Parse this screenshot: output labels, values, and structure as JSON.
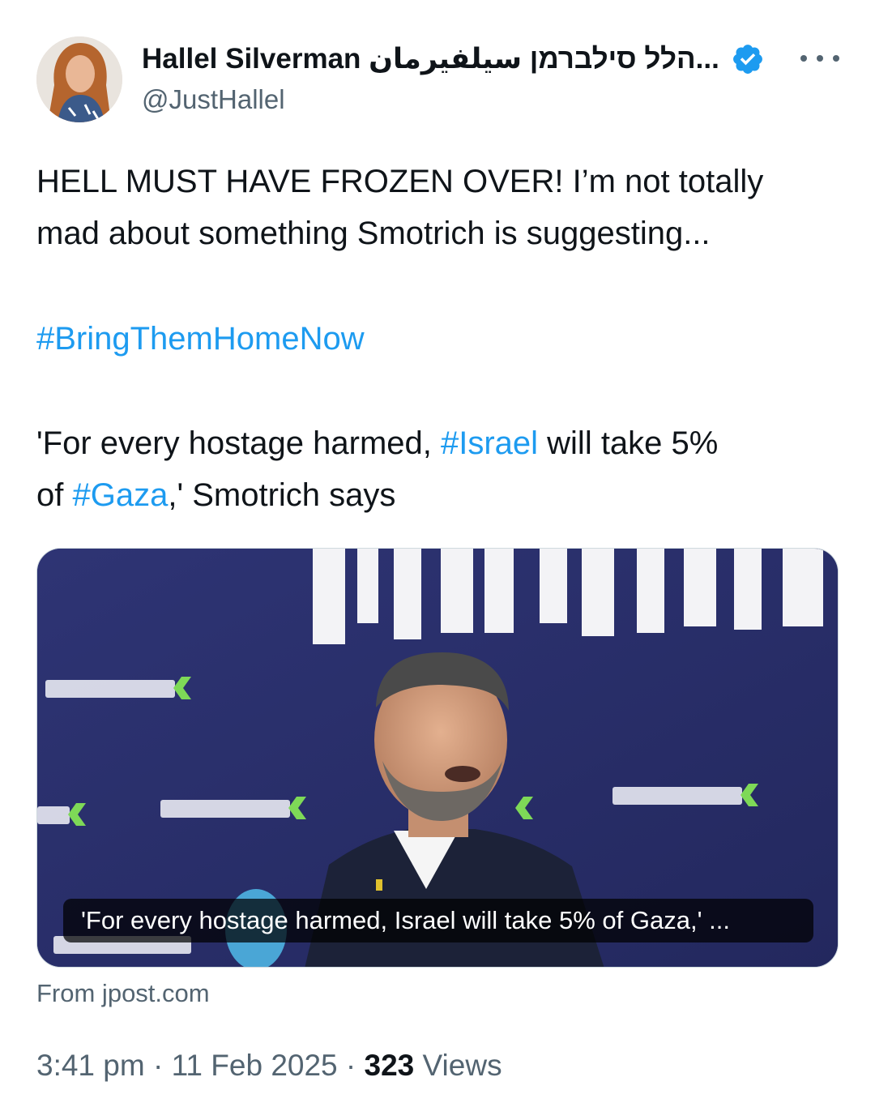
{
  "author": {
    "display_name": "Hallel Silverman הלל סילברמן سيلفيرمان...",
    "handle": "@JustHallel",
    "verified": true,
    "verified_color": "#1d9bf0",
    "more_icon": "more-horizontal-icon"
  },
  "tweet": {
    "line1": "HELL MUST HAVE FROZEN OVER! I’m not totally",
    "line2": "mad about something Smotrich is suggesting...",
    "hashtag_main": "#BringThemHomeNow",
    "quote_part1": "'For every hostage harmed, ",
    "hashtag_israel": "#Israel",
    "quote_part2": " will take 5%",
    "quote_part3": "of ",
    "hashtag_gaza": "#Gaza",
    "quote_part4": ",' Smotrich says"
  },
  "card": {
    "caption": "'For every hostage harmed, Israel will take 5% of Gaza,' ...",
    "source": "From jpost.com"
  },
  "meta": {
    "time": "3:41 pm",
    "separator": " · ",
    "date": "11 Feb 2025",
    "views_count": "323",
    "views_label": " Views"
  },
  "colors": {
    "link": "#1d9bf0",
    "secondary_text": "#536471",
    "banner_blue": "#2b3070"
  }
}
